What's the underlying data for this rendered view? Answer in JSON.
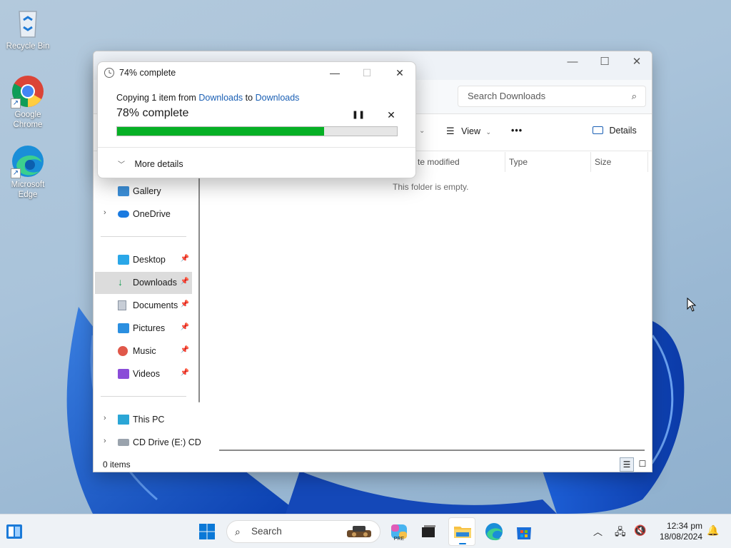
{
  "desktop": {
    "icons": [
      {
        "label": "Recycle Bin"
      },
      {
        "label": "Google Chrome"
      },
      {
        "label": "Microsoft Edge"
      }
    ]
  },
  "explorer": {
    "search_placeholder": "Search Downloads",
    "toolbar": {
      "view_label": "View",
      "more_label": "•••",
      "details_label": "Details"
    },
    "columns": [
      {
        "label": "te modified"
      },
      {
        "label": "Type"
      },
      {
        "label": "Size"
      }
    ],
    "empty_message": "This folder is empty.",
    "nav": {
      "gallery": "Gallery",
      "onedrive": "OneDrive",
      "desktop": "Desktop",
      "downloads": "Downloads",
      "documents": "Documents",
      "pictures": "Pictures",
      "music": "Music",
      "videos": "Videos",
      "thispc": "This PC",
      "cddrive": "CD Drive (E:) CD"
    },
    "status": "0 items"
  },
  "copy_dialog": {
    "title": "74% complete",
    "copy_prefix": "Copying 1 item from",
    "source": "Downloads",
    "to_word": "to",
    "destination": "Downloads",
    "percent_label": "78% complete",
    "progress_percent": 74,
    "more_details": "More details"
  },
  "taskbar": {
    "search_label": "Search",
    "time": "12:34 pm",
    "date": "18/08/2024"
  },
  "colors": {
    "progress": "#06b025",
    "link": "#1a5fb4",
    "accent": "#0067c0"
  }
}
